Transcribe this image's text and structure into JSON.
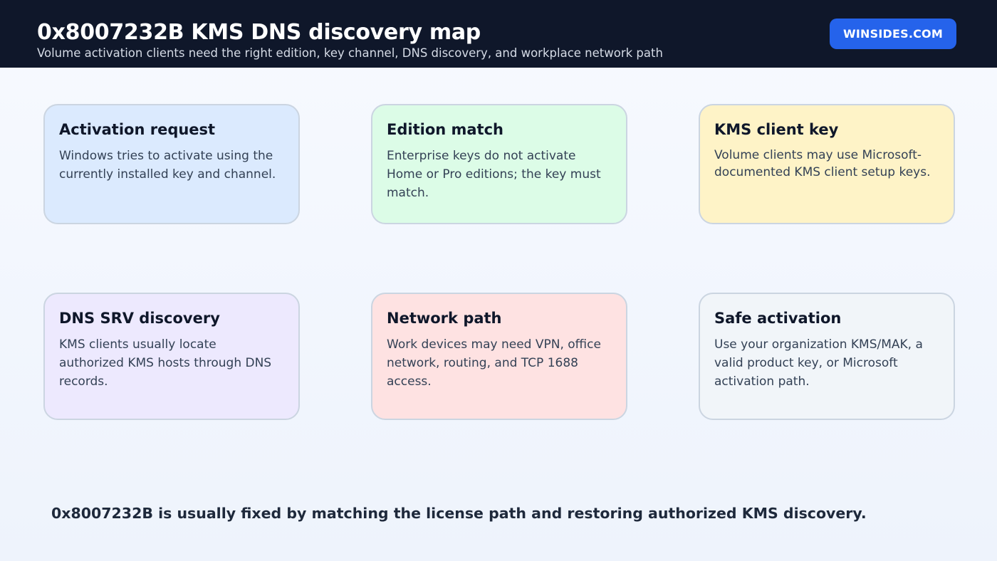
{
  "header": {
    "title": "0x8007232B KMS DNS discovery map",
    "subtitle": "Volume activation clients need the right edition, key channel, DNS discovery, and workplace network path",
    "brand": "WINSIDES.COM"
  },
  "cards": [
    {
      "title": "Activation request",
      "body": "Windows tries to activate using the currently installed key and channel.",
      "color": "#dbeafe"
    },
    {
      "title": "Edition match",
      "body": "Enterprise keys do not activate Home or Pro editions; the key must match.",
      "color": "#dcfce7"
    },
    {
      "title": "KMS client key",
      "body": "Volume clients may use Microsoft-documented KMS client setup keys.",
      "color": "#fef3c7"
    },
    {
      "title": "DNS SRV discovery",
      "body": "KMS clients usually locate authorized KMS hosts through DNS records.",
      "color": "#ede9fe"
    },
    {
      "title": "Network path",
      "body": "Work devices may need VPN, office network, routing, and TCP 1688 access.",
      "color": "#fee2e2"
    },
    {
      "title": "Safe activation",
      "body": "Use your organization KMS/MAK, a valid product key, or Microsoft activation path.",
      "color": "#f1f5f9"
    }
  ],
  "footer": {
    "note": "0x8007232B is usually fixed by matching the license path and restoring authorized KMS discovery."
  },
  "colors": {
    "header_bg": "#0f172a",
    "brand_bg": "#2563eb",
    "card_border": "#cbd5e1"
  }
}
